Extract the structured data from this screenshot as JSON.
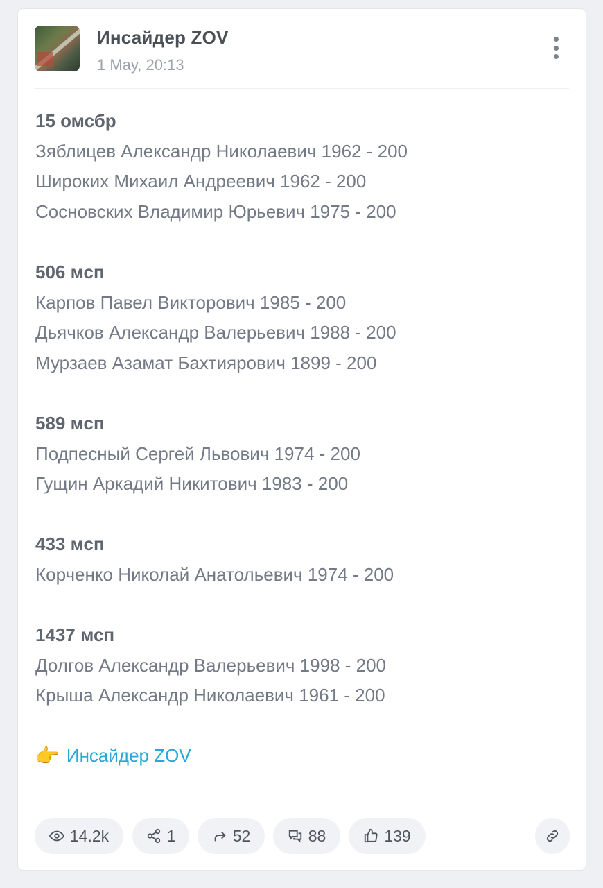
{
  "post": {
    "channel_name": "Инсайдер ZOV",
    "date": "1 May, 20:13",
    "sections": [
      {
        "unit": "15 омсбр",
        "lines": [
          "Зяблицев Александр Николаевич 1962 - 200",
          "Широких Михаил Андреевич 1962 - 200",
          "Сосновских Владимир Юрьевич 1975 - 200"
        ]
      },
      {
        "unit": "506 мсп",
        "lines": [
          "Карпов Павел Викторович 1985 - 200",
          "Дьячков Александр Валерьевич 1988 - 200",
          "Мурзаев Азамат Бахтиярович 1899 - 200"
        ]
      },
      {
        "unit": "589 мсп",
        "lines": [
          "Подпесный Сергей Львович 1974 - 200",
          "Гущин Аркадий Никитович 1983 - 200"
        ]
      },
      {
        "unit": "433 мсп",
        "lines": [
          "Корченко Николай Анатольевич 1974 - 200"
        ]
      },
      {
        "unit": "1437 мсп",
        "lines": [
          "Долгов Александр Валерьевич 1998 - 200",
          "Крыша Александр Николаевич 1961 - 200"
        ]
      }
    ],
    "signature_emoji": "👉",
    "signature_link": "Инсайдер ZOV"
  },
  "stats": {
    "views": "14.2k",
    "shares": "1",
    "forwards": "52",
    "comments": "88",
    "likes": "139"
  },
  "icons": [
    "eye-icon",
    "share-nodes-icon",
    "forward-arrow-icon",
    "comments-icon",
    "thumbs-up-icon",
    "link-icon",
    "more-vertical-icon"
  ],
  "colors": {
    "link": "#2aa7d6",
    "text": "#737a85",
    "background": "#eef0f3"
  }
}
